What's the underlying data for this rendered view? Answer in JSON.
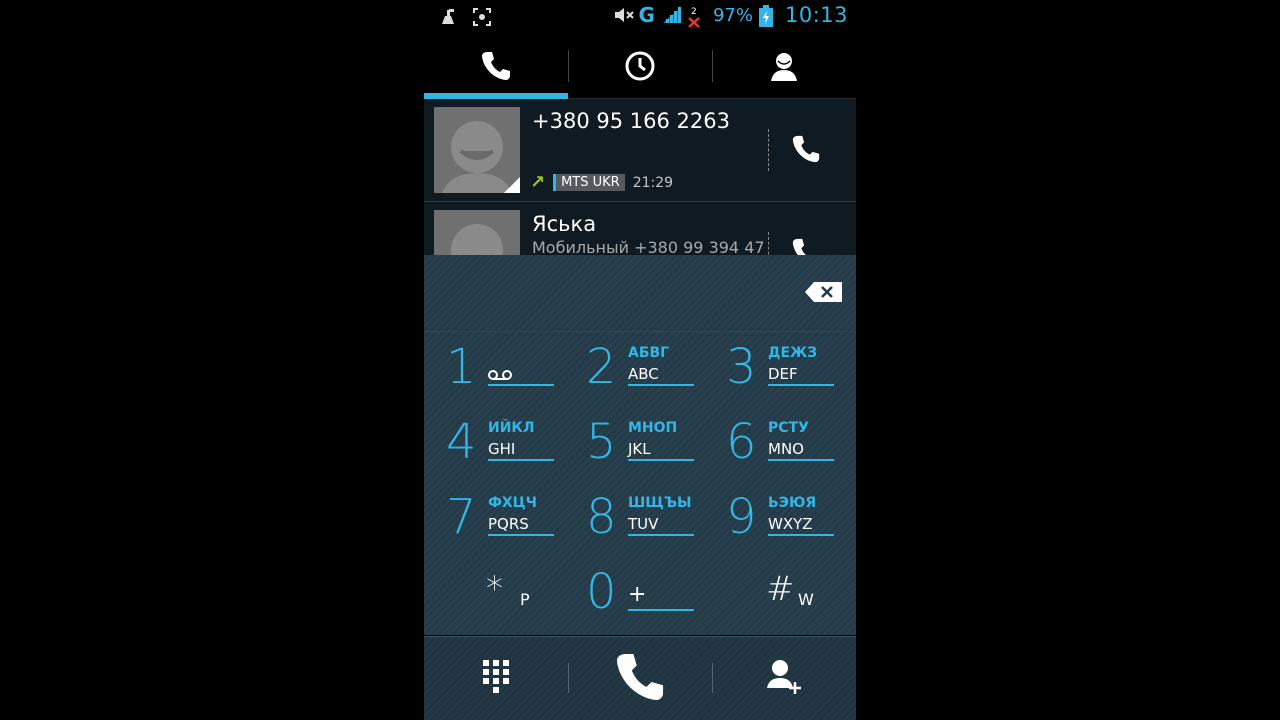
{
  "status_bar": {
    "left_icons": [
      "cleaner-icon",
      "screenshot-icon"
    ],
    "network": "G",
    "battery_percent": "97%",
    "time": "10:13",
    "accent_color": "#33b5e5"
  },
  "tabs": [
    {
      "name": "phone-tab",
      "icon": "phone-icon",
      "active": true
    },
    {
      "name": "recent-tab",
      "icon": "clock-icon",
      "active": false
    },
    {
      "name": "contacts-tab",
      "icon": "person-icon",
      "active": false
    }
  ],
  "call_log": [
    {
      "title": "+380 95 166 2263",
      "direction_icon": "outgoing-arrow-icon",
      "sim": "MTS UKR",
      "time": "21:29"
    },
    {
      "title": "Яська",
      "subtitle": "Мобильный +380 99 394 47"
    }
  ],
  "dialpad": {
    "keys": [
      {
        "digit": "1",
        "cyr": "",
        "lat": "",
        "icon": "voicemail-icon"
      },
      {
        "digit": "2",
        "cyr": "АБВГ",
        "lat": "ABC"
      },
      {
        "digit": "3",
        "cyr": "ДЕЖЗ",
        "lat": "DEF"
      },
      {
        "digit": "4",
        "cyr": "ИЙКЛ",
        "lat": "GHI"
      },
      {
        "digit": "5",
        "cyr": "МНОП",
        "lat": "JKL"
      },
      {
        "digit": "6",
        "cyr": "РСТУ",
        "lat": "MNO"
      },
      {
        "digit": "7",
        "cyr": "ФХЦЧ",
        "lat": "PQRS"
      },
      {
        "digit": "8",
        "cyr": "ШЩЪЫ",
        "lat": "TUV"
      },
      {
        "digit": "9",
        "cyr": "ЬЭЮЯ",
        "lat": "WXYZ"
      },
      {
        "digit": "*",
        "cyr": "",
        "lat": "P"
      },
      {
        "digit": "0",
        "cyr": "",
        "lat": "+"
      },
      {
        "digit": "#",
        "cyr": "",
        "lat": "W"
      }
    ]
  },
  "bottom_bar": {
    "left_icon": "dialpad-grid-icon",
    "center_icon": "call-icon",
    "right_icon": "add-contact-icon"
  }
}
